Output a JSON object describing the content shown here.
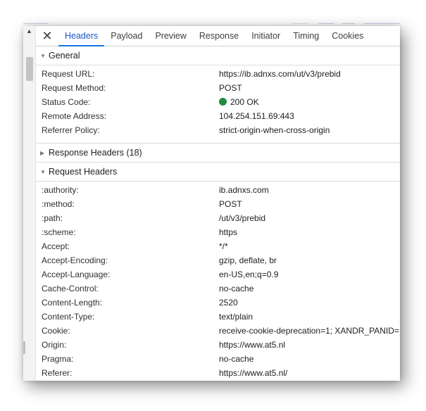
{
  "colors": {
    "accent": "#1a73e8",
    "status_ok": "#1e8e3e"
  },
  "scrollbar": {
    "up_arrow": "▲"
  },
  "close_symbol": "✕",
  "tabs": [
    {
      "label": "Headers",
      "active": true
    },
    {
      "label": "Payload"
    },
    {
      "label": "Preview"
    },
    {
      "label": "Response"
    },
    {
      "label": "Initiator"
    },
    {
      "label": "Timing"
    },
    {
      "label": "Cookies"
    }
  ],
  "general": {
    "title": "General",
    "expanded_icon": "▼",
    "rows": [
      {
        "key": "Request URL:",
        "value": "https://ib.adnxs.com/ut/v3/prebid"
      },
      {
        "key": "Request Method:",
        "value": "POST"
      },
      {
        "key": "Status Code:",
        "value": "200 OK"
      },
      {
        "key": "Remote Address:",
        "value": "104.254.151.69:443"
      },
      {
        "key": "Referrer Policy:",
        "value": "strict-origin-when-cross-origin"
      }
    ]
  },
  "response_headers": {
    "title": "Response Headers (18)",
    "collapsed_icon": "▶"
  },
  "request_headers": {
    "title": "Request Headers",
    "expanded_icon": "▼",
    "rows": [
      {
        "key": ":authority:",
        "value": "ib.adnxs.com"
      },
      {
        "key": ":method:",
        "value": "POST"
      },
      {
        "key": ":path:",
        "value": "/ut/v3/prebid"
      },
      {
        "key": ":scheme:",
        "value": "https"
      },
      {
        "key": "Accept:",
        "value": "*/*"
      },
      {
        "key": "Accept-Encoding:",
        "value": "gzip, deflate, br"
      },
      {
        "key": "Accept-Language:",
        "value": "en-US,en;q=0.9"
      },
      {
        "key": "Cache-Control:",
        "value": "no-cache"
      },
      {
        "key": "Content-Length:",
        "value": "2520"
      },
      {
        "key": "Content-Type:",
        "value": "text/plain"
      },
      {
        "key": "Cookie:",
        "value": "receive-cookie-deprecation=1; XANDR_PANID="
      },
      {
        "key": "Origin:",
        "value": "https://www.at5.nl"
      },
      {
        "key": "Pragma:",
        "value": "no-cache"
      },
      {
        "key": "Referer:",
        "value": "https://www.at5.nl/"
      }
    ]
  }
}
